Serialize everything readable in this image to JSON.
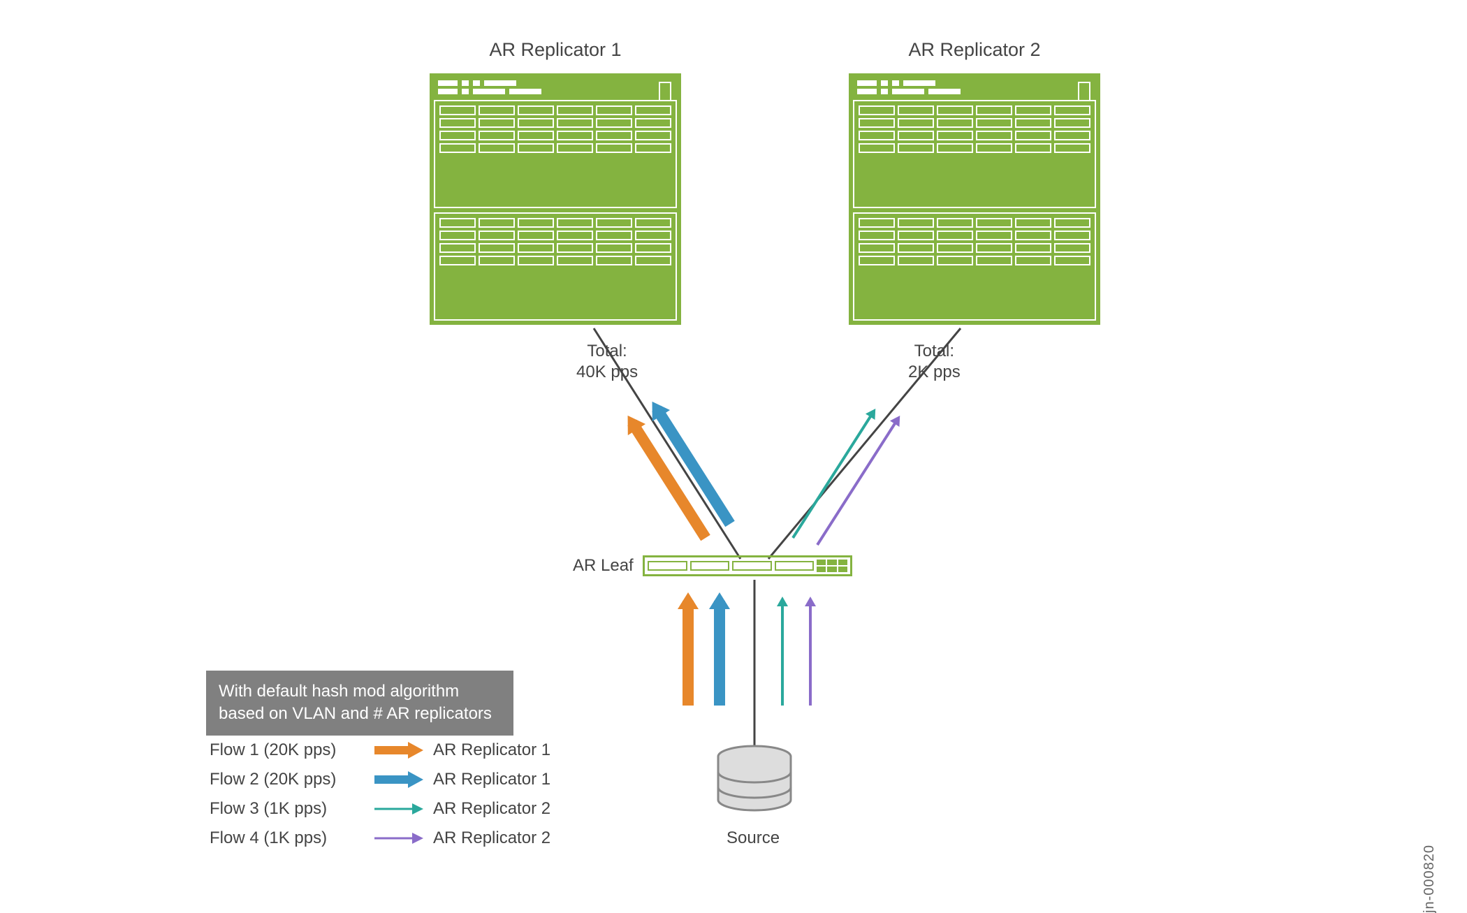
{
  "replicators": [
    {
      "title": "AR Replicator 1",
      "total_label": "Total:\n40K pps"
    },
    {
      "title": "AR Replicator 2",
      "total_label": "Total:\n2K pps"
    }
  ],
  "leaf_label": "AR Leaf",
  "source_label": "Source",
  "legend": {
    "header": "With default hash mod algorithm\nbased on VLAN and # AR replicators",
    "rows": [
      {
        "flow": "Flow 1 (20K pps)",
        "dest": "AR Replicator 1",
        "color": "#e7872b",
        "weight": "thick"
      },
      {
        "flow": "Flow 2 (20K pps)",
        "dest": "AR Replicator 1",
        "color": "#3a94c4",
        "weight": "thick"
      },
      {
        "flow": "Flow 3 (1K pps)",
        "dest": "AR Replicator 2",
        "color": "#2aa89c",
        "weight": "thin"
      },
      {
        "flow": "Flow 4 (1K pps)",
        "dest": "AR Replicator 2",
        "color": "#8a6cc9",
        "weight": "thin"
      }
    ]
  },
  "figure_id": "jn-000820",
  "colors": {
    "flow1": "#e7872b",
    "flow2": "#3a94c4",
    "flow3": "#2aa89c",
    "flow4": "#8a6cc9",
    "device": "#84b340",
    "line": "#444444"
  }
}
